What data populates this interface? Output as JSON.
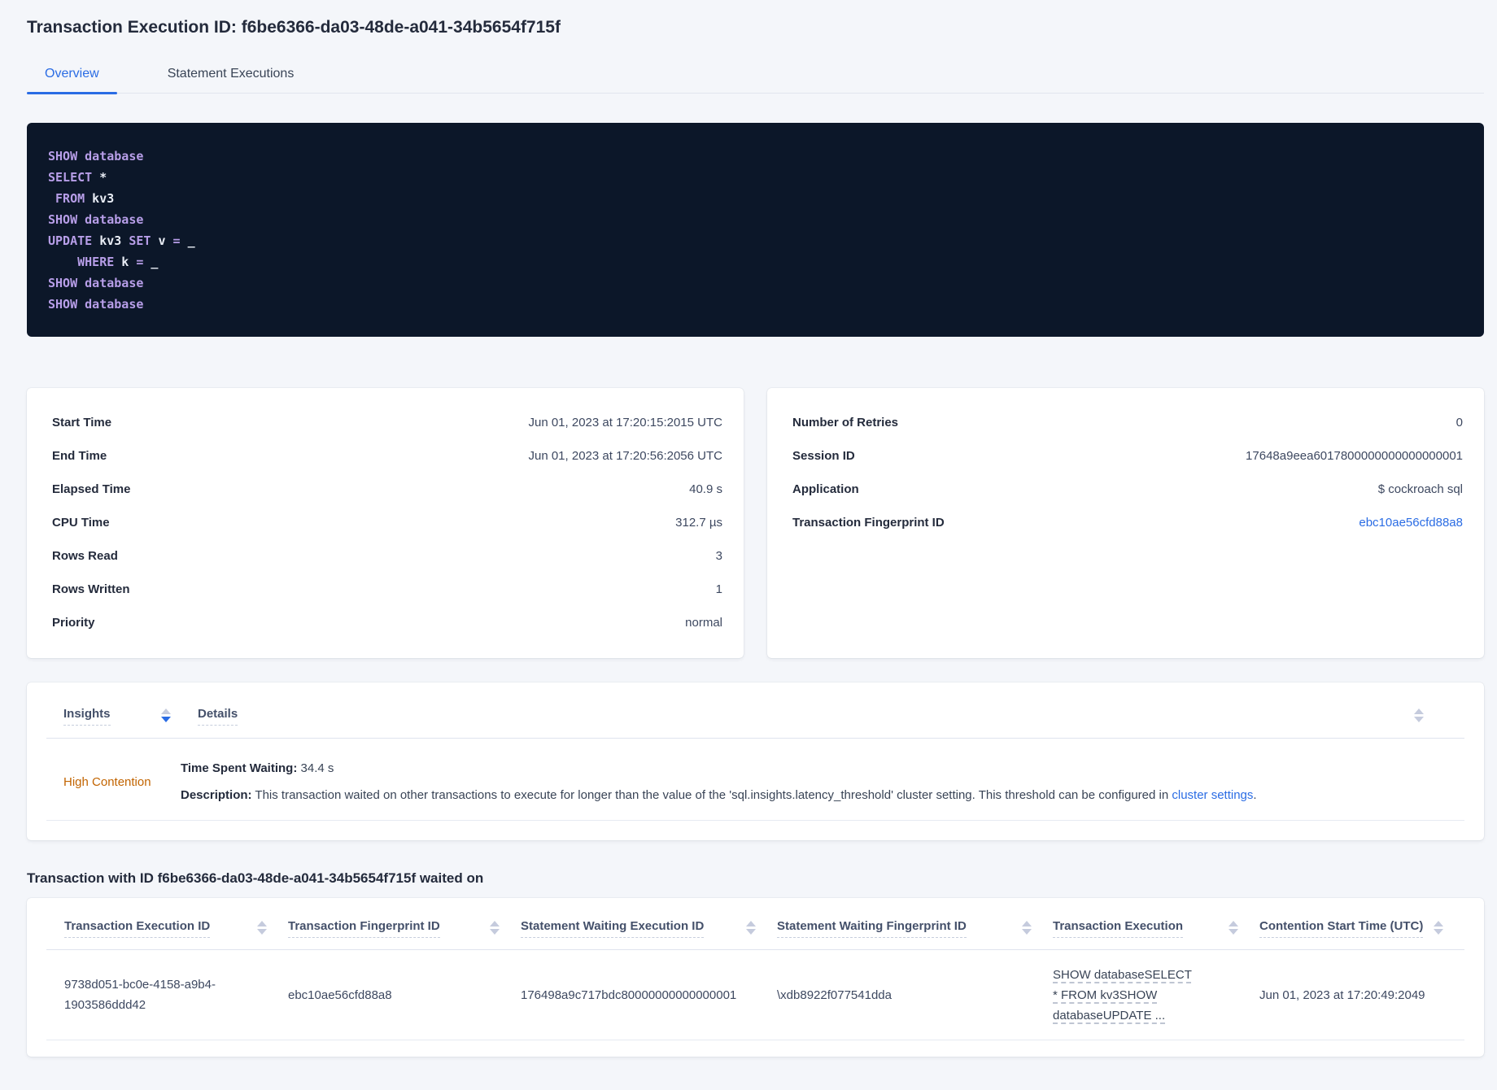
{
  "colors": {
    "accent_blue": "#2a6ce4",
    "insight_orange": "#c26400",
    "code_background": "#0c1729",
    "code_keyword": "#b79ee8",
    "code_plain": "#e9edf5",
    "page_background": "#f4f6fa"
  },
  "header": {
    "title": "Transaction Execution ID: f6be6366-da03-48de-a041-34b5654f715f"
  },
  "tabs": [
    {
      "label": "Overview",
      "active": true
    },
    {
      "label": "Statement Executions",
      "active": false
    }
  ],
  "sql": {
    "lines": [
      [
        {
          "text": "SHOW database",
          "kind": "kw"
        }
      ],
      [
        {
          "text": "SELECT",
          "kind": "kw"
        },
        {
          "text": " *",
          "kind": "pl"
        }
      ],
      [
        {
          "text": " ",
          "kind": "pl"
        },
        {
          "text": "FROM",
          "kind": "kw"
        },
        {
          "text": " kv3",
          "kind": "pl"
        }
      ],
      [
        {
          "text": "SHOW database",
          "kind": "kw"
        }
      ],
      [
        {
          "text": "UPDATE",
          "kind": "kw"
        },
        {
          "text": " kv3 ",
          "kind": "pl"
        },
        {
          "text": "SET",
          "kind": "kw"
        },
        {
          "text": " v ",
          "kind": "pl"
        },
        {
          "text": "=",
          "kind": "kw"
        },
        {
          "text": " _",
          "kind": "pl"
        }
      ],
      [
        {
          "text": "    ",
          "kind": "pl"
        },
        {
          "text": "WHERE",
          "kind": "kw"
        },
        {
          "text": " k ",
          "kind": "pl"
        },
        {
          "text": "=",
          "kind": "kw"
        },
        {
          "text": " _",
          "kind": "pl"
        }
      ],
      [
        {
          "text": "SHOW database",
          "kind": "kw"
        }
      ],
      [
        {
          "text": "SHOW database",
          "kind": "kw"
        }
      ]
    ]
  },
  "summary_left": {
    "rows": [
      {
        "label": "Start Time",
        "value": "Jun 01, 2023 at 17:20:15:2015 UTC"
      },
      {
        "label": "End Time",
        "value": "Jun 01, 2023 at 17:20:56:2056 UTC"
      },
      {
        "label": "Elapsed Time",
        "value": "40.9 s"
      },
      {
        "label": "CPU Time",
        "value": "312.7 µs"
      },
      {
        "label": "Rows Read",
        "value": "3"
      },
      {
        "label": "Rows Written",
        "value": "1"
      },
      {
        "label": "Priority",
        "value": "normal"
      }
    ]
  },
  "summary_right": {
    "rows": [
      {
        "label": "Number of Retries",
        "value": "0"
      },
      {
        "label": "Session ID",
        "value": "17648a9eea6017800000000000000001"
      },
      {
        "label": "Application",
        "value": "$ cockroach sql"
      },
      {
        "label": "Transaction Fingerprint ID",
        "value": "ebc10ae56cfd88a8",
        "link": true
      }
    ]
  },
  "insights": {
    "columns": [
      {
        "label": "Insights",
        "sorted": "desc"
      },
      {
        "label": "Details",
        "sorted": null
      }
    ],
    "row": {
      "insight": "High Contention",
      "waiting_label": "Time Spent Waiting:",
      "waiting_value": " 34.4 s",
      "description_label": "Description:",
      "description_text": " This transaction waited on other transactions to execute for longer than the value of the 'sql.insights.latency_threshold' cluster setting. This threshold can be configured in ",
      "description_link": "cluster settings",
      "description_end": "."
    }
  },
  "waited_on": {
    "heading": "Transaction with ID f6be6366-da03-48de-a041-34b5654f715f waited on",
    "columns": [
      "Transaction Execution ID",
      "Transaction Fingerprint ID",
      "Statement Waiting Execution ID",
      "Statement Waiting Fingerprint ID",
      "Transaction Execution",
      "Contention Start Time (UTC)"
    ],
    "row": {
      "transaction_execution_id": "9738d051-bc0e-4158-a9b4-1903586ddd42",
      "transaction_fingerprint_id": "ebc10ae56cfd88a8",
      "statement_waiting_execution_id": "176498a9c717bdc80000000000000001",
      "statement_waiting_fingerprint_id": "\\xdb8922f077541dda",
      "transaction_execution": "SHOW databaseSELECT * FROM kv3SHOW databaseUPDATE ...",
      "contention_start_time": "Jun 01, 2023 at 17:20:49:2049"
    }
  }
}
